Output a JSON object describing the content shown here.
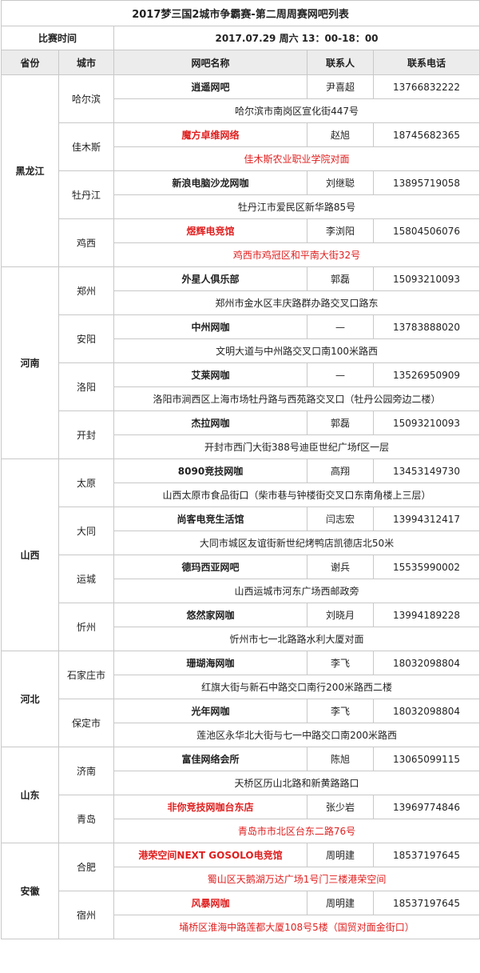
{
  "title": "2017梦三国2城市争霸赛-第二周周赛网吧列表",
  "time_label": "比赛时间",
  "time_value": "2017.07.29 周六 13：00-18：00",
  "headers": [
    "省份",
    "城市",
    "网吧名称",
    "联系人",
    "联系电话"
  ],
  "rows": [
    {
      "name": "逍遥网吧",
      "contact": "尹喜超",
      "phone": "13766832222",
      "address": "哈尔滨市南岗区宣化街447号",
      "red": false
    },
    {
      "name": "魔方卓维网络",
      "contact": "赵旭",
      "phone": "18745682365",
      "address": "佳木斯农业职业学院对面",
      "red": true
    },
    {
      "name": "新浪电脑沙龙网咖",
      "contact": "刘继聪",
      "phone": "13895719058",
      "address": "牡丹江市爱民区新华路85号",
      "red": false
    },
    {
      "name": "煜辉电竞馆",
      "contact": "李浏阳",
      "phone": "15804506076",
      "address": "鸡西市鸡冠区和平南大街32号",
      "red": true
    },
    {
      "name": "外星人俱乐部",
      "contact": "郭磊",
      "phone": "15093210093",
      "address": "郑州市金水区丰庆路群办路交叉口路东",
      "red": false
    },
    {
      "name": "中州网咖",
      "contact": "—",
      "phone": "13783888020",
      "address": "文明大道与中州路交叉口南100米路西",
      "red": false
    },
    {
      "name": "艾莱网咖",
      "contact": "—",
      "phone": "13526950909",
      "address": "洛阳市涧西区上海市场牡丹路与西苑路交叉口（牡丹公园旁边二楼）",
      "red": false
    },
    {
      "name": "杰拉网咖",
      "contact": "郭磊",
      "phone": "15093210093",
      "address": "开封市西门大街388号迪臣世纪广场f区一层",
      "red": false
    },
    {
      "name": "8090竞技网咖",
      "contact": "高翔",
      "phone": "13453149730",
      "address": "山西太原市食品街口（柴市巷与钟楼街交叉口东南角楼上三层）",
      "red": false
    },
    {
      "name": "尚客电竞生活馆",
      "contact": "闫志宏",
      "phone": "13994312417",
      "address": "大同市城区友谊街新世纪烤鸭店凯德店北50米",
      "red": false
    },
    {
      "name": "德玛西亚网吧",
      "contact": "谢兵",
      "phone": "15535990002",
      "address": "山西运城市河东广场西邮政旁",
      "red": false
    },
    {
      "name": "悠然家网咖",
      "contact": "刘晓月",
      "phone": "13994189228",
      "address": "忻州市七一北路路水利大厦对面",
      "red": false
    },
    {
      "name": "珊瑚海网咖",
      "contact": "李飞",
      "phone": "18032098804",
      "address": "红旗大街与新石中路交口南行200米路西二楼",
      "red": false
    },
    {
      "name": "光年网咖",
      "contact": "李飞",
      "phone": "18032098804",
      "address": "莲池区永华北大街与七一中路交口南200米路西",
      "red": false
    },
    {
      "name": "富佳网络会所",
      "contact": "陈旭",
      "phone": "13065099115",
      "address": "天桥区历山北路和新黄路路口",
      "red": false
    },
    {
      "name": "非你竞技网咖台东店",
      "contact": "张少岩",
      "phone": "13969774846",
      "address": "青岛市市北区台东二路76号",
      "red": true
    },
    {
      "name": "港荣空间NEXT GOSOLO电竞馆",
      "contact": "周明建",
      "phone": "18537197645",
      "address": "蜀山区天鹅湖万达广场1号门三楼港荣空间",
      "red": true
    },
    {
      "name": "风暴网咖",
      "contact": "周明建",
      "phone": "18537197645",
      "address": "埇桥区淮海中路莲都大厦108号5楼（国贸对面金街口）",
      "red": true
    }
  ],
  "provinces": [
    {
      "name": "黑龙江",
      "cities": [
        "哈尔滨",
        "佳木斯",
        "牡丹江",
        "鸡西"
      ]
    },
    {
      "name": "河南",
      "cities": [
        "郑州",
        "安阳",
        "洛阳",
        "开封"
      ]
    },
    {
      "name": "山西",
      "cities": [
        "太原",
        "大同",
        "运城",
        "忻州"
      ]
    },
    {
      "name": "河北",
      "cities": [
        "石家庄市",
        "保定市"
      ]
    },
    {
      "name": "山东",
      "cities": [
        "济南",
        "青岛"
      ]
    },
    {
      "name": "安徽",
      "cities": [
        "合肥",
        "宿州"
      ]
    }
  ]
}
